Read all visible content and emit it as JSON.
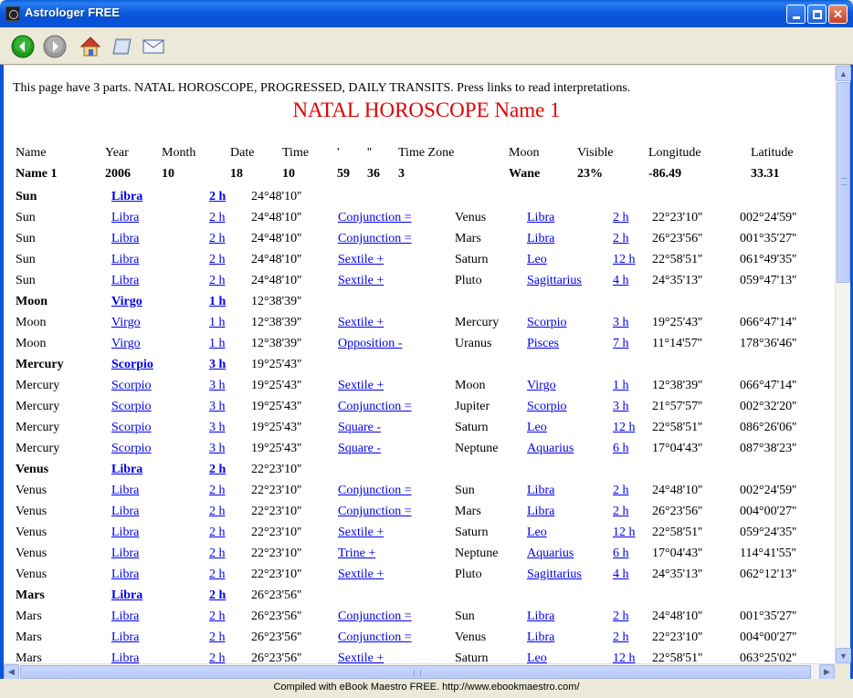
{
  "window": {
    "title": "Astrologer FREE"
  },
  "toolbar": {
    "buttons": [
      "back-icon",
      "forward-icon",
      "home-icon",
      "book-icon",
      "mail-icon"
    ]
  },
  "intro": "This page have 3 parts. NATAL HOROSCOPE, PROGRESSED, DAILY TRANSITS. Press links to read interpretations.",
  "title": "NATAL HOROSCOPE Name 1",
  "header": {
    "labels": [
      "Name",
      "Year",
      "Month",
      "Date",
      "Time",
      "'",
      "''",
      "Time Zone",
      "Moon",
      "Visible",
      "Longitude",
      "Latitude"
    ],
    "values": [
      "Name 1",
      "2006",
      "10",
      "18",
      "10",
      "59",
      "36",
      "3",
      "Wane",
      "23%",
      "-86.49",
      "33.31"
    ]
  },
  "rows": [
    {
      "type": "planet",
      "planet": "Sun",
      "sign": "Libra",
      "house": "2 h",
      "degree": "24°48'10''"
    },
    {
      "type": "aspect",
      "planet": "Sun",
      "sign": "Libra",
      "house": "2 h",
      "degree": "24°48'10''",
      "aspect": "Conjunction =",
      "planet2": "Venus",
      "sign2": "Libra",
      "house2": "2 h",
      "degree2": "22°23'10''",
      "orb": "002°24'59''"
    },
    {
      "type": "aspect",
      "planet": "Sun",
      "sign": "Libra",
      "house": "2 h",
      "degree": "24°48'10''",
      "aspect": "Conjunction =",
      "planet2": "Mars",
      "sign2": "Libra",
      "house2": "2 h",
      "degree2": "26°23'56''",
      "orb": "001°35'27''"
    },
    {
      "type": "aspect",
      "planet": "Sun",
      "sign": "Libra",
      "house": "2 h",
      "degree": "24°48'10''",
      "aspect": "Sextile +",
      "planet2": "Saturn",
      "sign2": "Leo",
      "house2": "12 h",
      "degree2": "22°58'51''",
      "orb": "061°49'35''"
    },
    {
      "type": "aspect",
      "planet": "Sun",
      "sign": "Libra",
      "house": "2 h",
      "degree": "24°48'10''",
      "aspect": "Sextile +",
      "planet2": "Pluto",
      "sign2": "Sagittarius",
      "house2": "4 h",
      "degree2": "24°35'13''",
      "orb": "059°47'13''"
    },
    {
      "type": "planet",
      "planet": "Moon",
      "sign": "Virgo",
      "house": "1 h",
      "degree": "12°38'39''"
    },
    {
      "type": "aspect",
      "planet": "Moon",
      "sign": "Virgo",
      "house": "1 h",
      "degree": "12°38'39''",
      "aspect": "Sextile +",
      "planet2": "Mercury",
      "sign2": "Scorpio",
      "house2": "3 h",
      "degree2": "19°25'43''",
      "orb": "066°47'14''"
    },
    {
      "type": "aspect",
      "planet": "Moon",
      "sign": "Virgo",
      "house": "1 h",
      "degree": "12°38'39''",
      "aspect": "Opposition -",
      "planet2": "Uranus",
      "sign2": "Pisces",
      "house2": "7 h",
      "degree2": "11°14'57''",
      "orb": "178°36'46''"
    },
    {
      "type": "planet",
      "planet": "Mercury",
      "sign": "Scorpio",
      "house": "3 h",
      "degree": "19°25'43''"
    },
    {
      "type": "aspect",
      "planet": "Mercury",
      "sign": "Scorpio",
      "house": "3 h",
      "degree": "19°25'43''",
      "aspect": "Sextile +",
      "planet2": "Moon",
      "sign2": "Virgo",
      "house2": "1 h",
      "degree2": "12°38'39''",
      "orb": "066°47'14''"
    },
    {
      "type": "aspect",
      "planet": "Mercury",
      "sign": "Scorpio",
      "house": "3 h",
      "degree": "19°25'43''",
      "aspect": "Conjunction =",
      "planet2": "Jupiter",
      "sign2": "Scorpio",
      "house2": "3 h",
      "degree2": "21°57'57''",
      "orb": "002°32'20''"
    },
    {
      "type": "aspect",
      "planet": "Mercury",
      "sign": "Scorpio",
      "house": "3 h",
      "degree": "19°25'43''",
      "aspect": "Square -",
      "planet2": "Saturn",
      "sign2": "Leo",
      "house2": "12 h",
      "degree2": "22°58'51''",
      "orb": "086°26'06''"
    },
    {
      "type": "aspect",
      "planet": "Mercury",
      "sign": "Scorpio",
      "house": "3 h",
      "degree": "19°25'43''",
      "aspect": "Square -",
      "planet2": "Neptune",
      "sign2": "Aquarius",
      "house2": "6 h",
      "degree2": "17°04'43''",
      "orb": "087°38'23''"
    },
    {
      "type": "planet",
      "planet": "Venus",
      "sign": "Libra",
      "house": "2 h",
      "degree": "22°23'10''"
    },
    {
      "type": "aspect",
      "planet": "Venus",
      "sign": "Libra",
      "house": "2 h",
      "degree": "22°23'10''",
      "aspect": "Conjunction =",
      "planet2": "Sun",
      "sign2": "Libra",
      "house2": "2 h",
      "degree2": "24°48'10''",
      "orb": "002°24'59''"
    },
    {
      "type": "aspect",
      "planet": "Venus",
      "sign": "Libra",
      "house": "2 h",
      "degree": "22°23'10''",
      "aspect": "Conjunction =",
      "planet2": "Mars",
      "sign2": "Libra",
      "house2": "2 h",
      "degree2": "26°23'56''",
      "orb": "004°00'27''"
    },
    {
      "type": "aspect",
      "planet": "Venus",
      "sign": "Libra",
      "house": "2 h",
      "degree": "22°23'10''",
      "aspect": "Sextile +",
      "planet2": "Saturn",
      "sign2": "Leo",
      "house2": "12 h",
      "degree2": "22°58'51''",
      "orb": "059°24'35''"
    },
    {
      "type": "aspect",
      "planet": "Venus",
      "sign": "Libra",
      "house": "2 h",
      "degree": "22°23'10''",
      "aspect": "Trine +",
      "planet2": "Neptune",
      "sign2": "Aquarius",
      "house2": "6 h",
      "degree2": "17°04'43''",
      "orb": "114°41'55''"
    },
    {
      "type": "aspect",
      "planet": "Venus",
      "sign": "Libra",
      "house": "2 h",
      "degree": "22°23'10''",
      "aspect": "Sextile +",
      "planet2": "Pluto",
      "sign2": "Sagittarius",
      "house2": "4 h",
      "degree2": "24°35'13''",
      "orb": "062°12'13''"
    },
    {
      "type": "planet",
      "planet": "Mars",
      "sign": "Libra",
      "house": "2 h",
      "degree": "26°23'56''"
    },
    {
      "type": "aspect",
      "planet": "Mars",
      "sign": "Libra",
      "house": "2 h",
      "degree": "26°23'56''",
      "aspect": "Conjunction =",
      "planet2": "Sun",
      "sign2": "Libra",
      "house2": "2 h",
      "degree2": "24°48'10''",
      "orb": "001°35'27''"
    },
    {
      "type": "aspect",
      "planet": "Mars",
      "sign": "Libra",
      "house": "2 h",
      "degree": "26°23'56''",
      "aspect": "Conjunction =",
      "planet2": "Venus",
      "sign2": "Libra",
      "house2": "2 h",
      "degree2": "22°23'10''",
      "orb": "004°00'27''"
    },
    {
      "type": "aspect",
      "planet": "Mars",
      "sign": "Libra",
      "house": "2 h",
      "degree": "26°23'56''",
      "aspect": "Sextile +",
      "planet2": "Saturn",
      "sign2": "Leo",
      "house2": "12 h",
      "degree2": "22°58'51''",
      "orb": "063°25'02''"
    }
  ],
  "status": "Compiled with eBook Maestro FREE. http://www.ebookmaestro.com/",
  "colors": {
    "title_red": "#e00000",
    "link_blue": "#0000ee",
    "titlebar_blue": "#0b54d6"
  }
}
